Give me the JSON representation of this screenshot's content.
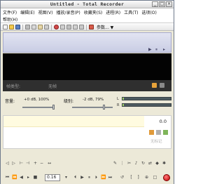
{
  "window": {
    "title": "Untitled - Total Recorder",
    "controls": [
      "_",
      "□",
      "×"
    ]
  },
  "menus": {
    "row1": [
      "文件(F)",
      "编辑(E)",
      "视图(V)",
      "播放/录音(P)",
      "收藏夹(S)",
      "进程(R)",
      "工具(T)",
      "选项(O)"
    ],
    "row2": [
      "帮助(H)"
    ]
  },
  "toolbar": {
    "param_label": "参数...",
    "dropdown_arrow": "▼"
  },
  "status": {
    "label": "帧类型:",
    "value": "无帧"
  },
  "levels": {
    "volume_label": "音量:",
    "volume_value": "+0 dB, 100%",
    "volume_level": 1.0,
    "gain_label": "级别:",
    "gain_value": "-2 dB, 79%",
    "gain_level": 0.79,
    "meter_l": "L",
    "meter_r": "R"
  },
  "timeline": {
    "time": "0.0",
    "mark_labels": [
      "无标记"
    ]
  },
  "transport": {
    "position": "0.16"
  }
}
